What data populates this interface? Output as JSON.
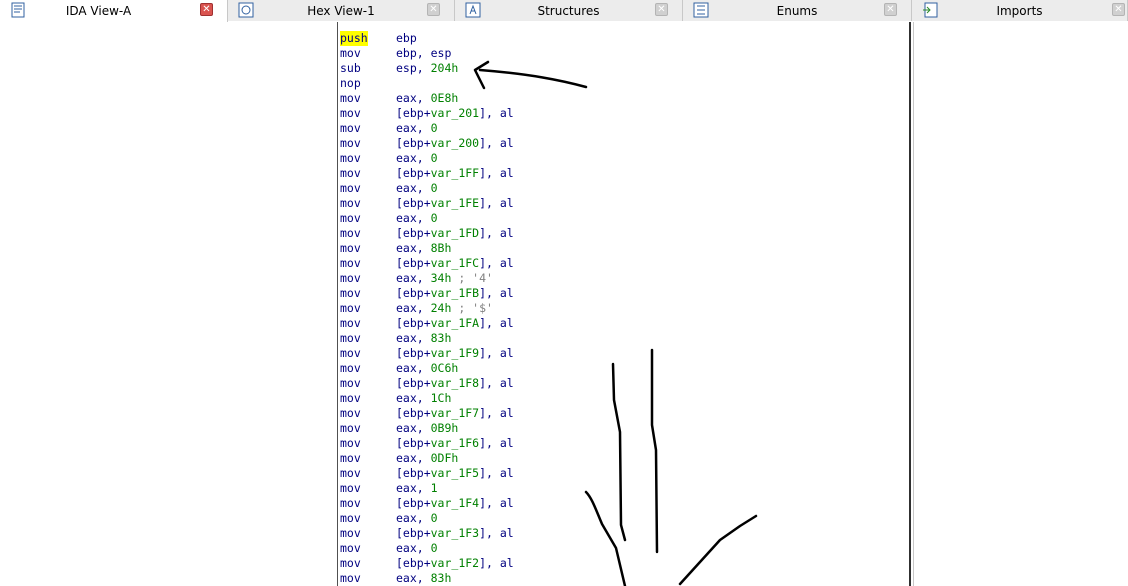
{
  "tabs": [
    {
      "label": "IDA View-A",
      "icon": "ida-view-icon",
      "active": true
    },
    {
      "label": "Hex View-1",
      "icon": "hex-view-icon",
      "active": false
    },
    {
      "label": "Structures",
      "icon": "structures-icon",
      "active": false
    },
    {
      "label": "Enums",
      "icon": "enums-icon",
      "active": false
    },
    {
      "label": "Imports",
      "icon": "imports-icon",
      "active": false
    }
  ],
  "code": [
    {
      "mn": "push",
      "ops": [
        {
          "t": "ebp",
          "c": "reg"
        }
      ]
    },
    {
      "mn": "mov",
      "ops": [
        {
          "t": "ebp, esp",
          "c": "reg"
        }
      ]
    },
    {
      "mn": "sub",
      "ops": [
        {
          "t": "esp, ",
          "c": "reg"
        },
        {
          "t": "204h",
          "c": "num"
        }
      ]
    },
    {
      "mn": "nop",
      "ops": []
    },
    {
      "mn": "mov",
      "ops": [
        {
          "t": "eax, ",
          "c": "reg"
        },
        {
          "t": "0E8h",
          "c": "num"
        }
      ]
    },
    {
      "mn": "mov",
      "ops": [
        {
          "t": "[ebp+",
          "c": "reg"
        },
        {
          "t": "var_201",
          "c": "var"
        },
        {
          "t": "], al",
          "c": "reg"
        }
      ]
    },
    {
      "mn": "mov",
      "ops": [
        {
          "t": "eax, ",
          "c": "reg"
        },
        {
          "t": "0",
          "c": "num"
        }
      ]
    },
    {
      "mn": "mov",
      "ops": [
        {
          "t": "[ebp+",
          "c": "reg"
        },
        {
          "t": "var_200",
          "c": "var"
        },
        {
          "t": "], al",
          "c": "reg"
        }
      ]
    },
    {
      "mn": "mov",
      "ops": [
        {
          "t": "eax, ",
          "c": "reg"
        },
        {
          "t": "0",
          "c": "num"
        }
      ]
    },
    {
      "mn": "mov",
      "ops": [
        {
          "t": "[ebp+",
          "c": "reg"
        },
        {
          "t": "var_1FF",
          "c": "var"
        },
        {
          "t": "], al",
          "c": "reg"
        }
      ]
    },
    {
      "mn": "mov",
      "ops": [
        {
          "t": "eax, ",
          "c": "reg"
        },
        {
          "t": "0",
          "c": "num"
        }
      ]
    },
    {
      "mn": "mov",
      "ops": [
        {
          "t": "[ebp+",
          "c": "reg"
        },
        {
          "t": "var_1FE",
          "c": "var"
        },
        {
          "t": "], al",
          "c": "reg"
        }
      ]
    },
    {
      "mn": "mov",
      "ops": [
        {
          "t": "eax, ",
          "c": "reg"
        },
        {
          "t": "0",
          "c": "num"
        }
      ]
    },
    {
      "mn": "mov",
      "ops": [
        {
          "t": "[ebp+",
          "c": "reg"
        },
        {
          "t": "var_1FD",
          "c": "var"
        },
        {
          "t": "], al",
          "c": "reg"
        }
      ]
    },
    {
      "mn": "mov",
      "ops": [
        {
          "t": "eax, ",
          "c": "reg"
        },
        {
          "t": "8Bh",
          "c": "num"
        }
      ]
    },
    {
      "mn": "mov",
      "ops": [
        {
          "t": "[ebp+",
          "c": "reg"
        },
        {
          "t": "var_1FC",
          "c": "var"
        },
        {
          "t": "], al",
          "c": "reg"
        }
      ]
    },
    {
      "mn": "mov",
      "ops": [
        {
          "t": "eax, ",
          "c": "reg"
        },
        {
          "t": "34h",
          "c": "num"
        },
        {
          "t": " ; '4'",
          "c": "cmt"
        }
      ]
    },
    {
      "mn": "mov",
      "ops": [
        {
          "t": "[ebp+",
          "c": "reg"
        },
        {
          "t": "var_1FB",
          "c": "var"
        },
        {
          "t": "], al",
          "c": "reg"
        }
      ]
    },
    {
      "mn": "mov",
      "ops": [
        {
          "t": "eax, ",
          "c": "reg"
        },
        {
          "t": "24h",
          "c": "num"
        },
        {
          "t": " ; '$'",
          "c": "cmt"
        }
      ]
    },
    {
      "mn": "mov",
      "ops": [
        {
          "t": "[ebp+",
          "c": "reg"
        },
        {
          "t": "var_1FA",
          "c": "var"
        },
        {
          "t": "], al",
          "c": "reg"
        }
      ]
    },
    {
      "mn": "mov",
      "ops": [
        {
          "t": "eax, ",
          "c": "reg"
        },
        {
          "t": "83h",
          "c": "num"
        }
      ]
    },
    {
      "mn": "mov",
      "ops": [
        {
          "t": "[ebp+",
          "c": "reg"
        },
        {
          "t": "var_1F9",
          "c": "var"
        },
        {
          "t": "], al",
          "c": "reg"
        }
      ]
    },
    {
      "mn": "mov",
      "ops": [
        {
          "t": "eax, ",
          "c": "reg"
        },
        {
          "t": "0C6h",
          "c": "num"
        }
      ]
    },
    {
      "mn": "mov",
      "ops": [
        {
          "t": "[ebp+",
          "c": "reg"
        },
        {
          "t": "var_1F8",
          "c": "var"
        },
        {
          "t": "], al",
          "c": "reg"
        }
      ]
    },
    {
      "mn": "mov",
      "ops": [
        {
          "t": "eax, ",
          "c": "reg"
        },
        {
          "t": "1Ch",
          "c": "num"
        }
      ]
    },
    {
      "mn": "mov",
      "ops": [
        {
          "t": "[ebp+",
          "c": "reg"
        },
        {
          "t": "var_1F7",
          "c": "var"
        },
        {
          "t": "], al",
          "c": "reg"
        }
      ]
    },
    {
      "mn": "mov",
      "ops": [
        {
          "t": "eax, ",
          "c": "reg"
        },
        {
          "t": "0B9h",
          "c": "num"
        }
      ]
    },
    {
      "mn": "mov",
      "ops": [
        {
          "t": "[ebp+",
          "c": "reg"
        },
        {
          "t": "var_1F6",
          "c": "var"
        },
        {
          "t": "], al",
          "c": "reg"
        }
      ]
    },
    {
      "mn": "mov",
      "ops": [
        {
          "t": "eax, ",
          "c": "reg"
        },
        {
          "t": "0DFh",
          "c": "num"
        }
      ]
    },
    {
      "mn": "mov",
      "ops": [
        {
          "t": "[ebp+",
          "c": "reg"
        },
        {
          "t": "var_1F5",
          "c": "var"
        },
        {
          "t": "], al",
          "c": "reg"
        }
      ]
    },
    {
      "mn": "mov",
      "ops": [
        {
          "t": "eax, ",
          "c": "reg"
        },
        {
          "t": "1",
          "c": "num"
        }
      ]
    },
    {
      "mn": "mov",
      "ops": [
        {
          "t": "[ebp+",
          "c": "reg"
        },
        {
          "t": "var_1F4",
          "c": "var"
        },
        {
          "t": "], al",
          "c": "reg"
        }
      ]
    },
    {
      "mn": "mov",
      "ops": [
        {
          "t": "eax, ",
          "c": "reg"
        },
        {
          "t": "0",
          "c": "num"
        }
      ]
    },
    {
      "mn": "mov",
      "ops": [
        {
          "t": "[ebp+",
          "c": "reg"
        },
        {
          "t": "var_1F3",
          "c": "var"
        },
        {
          "t": "], al",
          "c": "reg"
        }
      ]
    },
    {
      "mn": "mov",
      "ops": [
        {
          "t": "eax, ",
          "c": "reg"
        },
        {
          "t": "0",
          "c": "num"
        }
      ]
    },
    {
      "mn": "mov",
      "ops": [
        {
          "t": "[ebp+",
          "c": "reg"
        },
        {
          "t": "var_1F2",
          "c": "var"
        },
        {
          "t": "], al",
          "c": "reg"
        }
      ]
    },
    {
      "mn": "mov",
      "ops": [
        {
          "t": "eax, ",
          "c": "reg"
        },
        {
          "t": "83h",
          "c": "num"
        }
      ]
    }
  ],
  "highlighted_mnemonic": "push",
  "colors": {
    "mnemonic": "#000080",
    "constant": "#008000",
    "comment": "#808080",
    "highlight": "#ffff00"
  }
}
